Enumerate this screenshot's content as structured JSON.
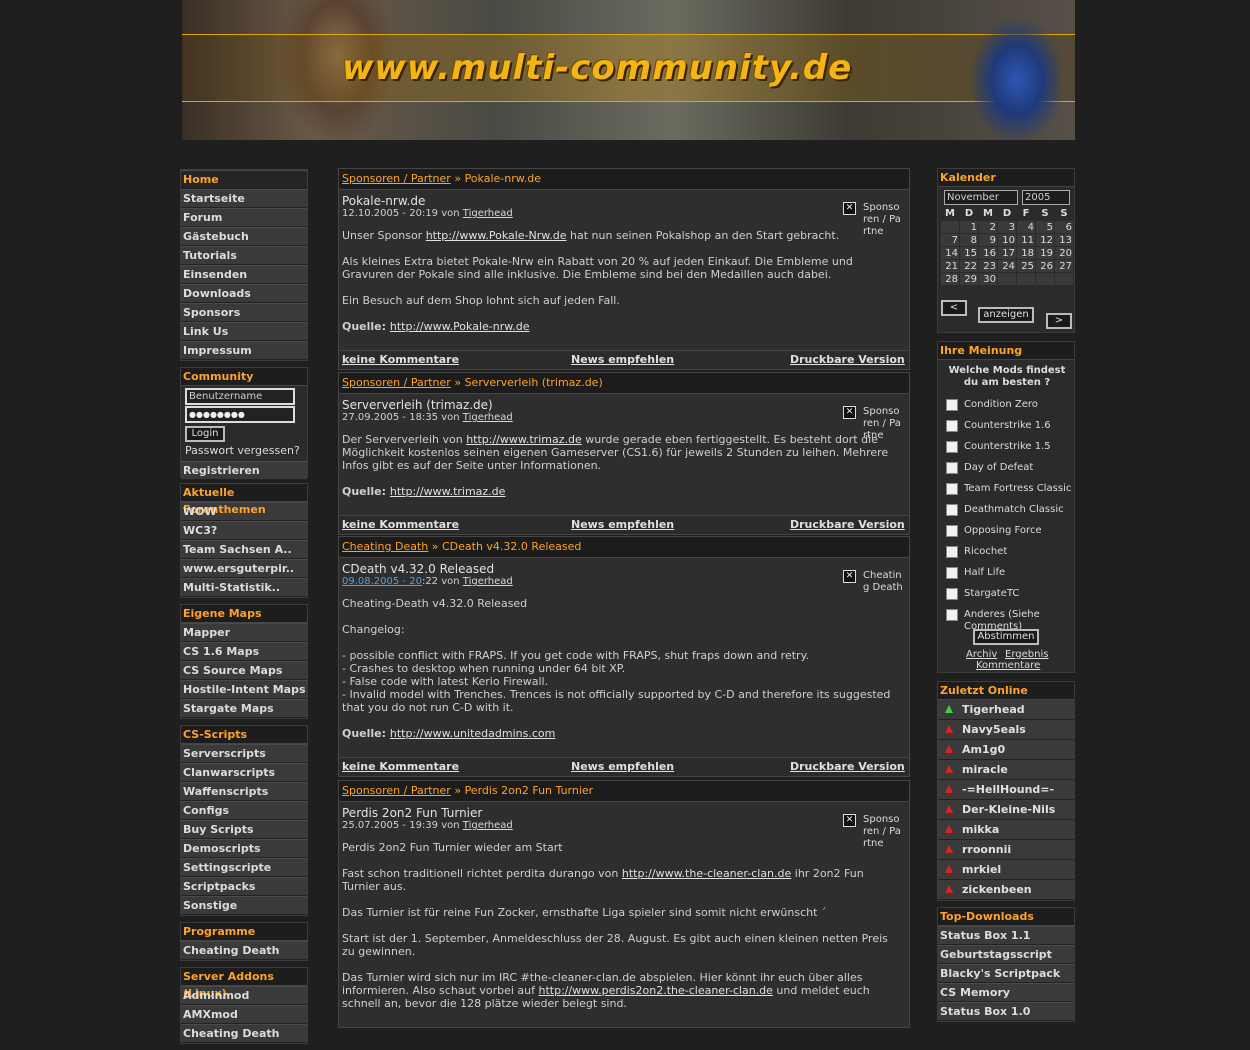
{
  "header": {
    "logo_text": "www.multi-community.de"
  },
  "menu": {
    "title": "Home",
    "items": [
      "Startseite",
      "Forum",
      "Gästebuch",
      "Tutorials",
      "Einsenden",
      "Downloads",
      "Sponsors",
      "Link Us",
      "Impressum"
    ]
  },
  "community": {
    "title": "Community",
    "username_value": "Benutzername",
    "password_value": "●●●●●●●●",
    "login_label": "Login",
    "forgot_label": "Passwort vergessen?",
    "register_label": "Registrieren"
  },
  "forum": {
    "title": "Aktuelle Forenthemen",
    "items": [
      "WOW",
      "WC3?",
      "Team Sachsen A..",
      "www.ersguterpir..",
      "Multi-Statistik.."
    ]
  },
  "maps": {
    "title": "Eigene Maps",
    "items": [
      "Mapper",
      "CS 1.6 Maps",
      "CS Source Maps",
      "Hostile-Intent Maps",
      "Stargate Maps"
    ]
  },
  "scripts": {
    "title": "CS-Scripts",
    "items": [
      "Serverscripts",
      "Clanwarscripts",
      "Waffenscripts",
      "Configs",
      "Buy Scripts",
      "Demoscripts",
      "Settingscripte",
      "Scriptpacks",
      "Sonstige"
    ]
  },
  "programme": {
    "title": "Programme",
    "items": [
      "Cheating Death"
    ]
  },
  "addons": {
    "title": "Server Addons (Linux)",
    "items": [
      "Adminmod",
      "AMXmod",
      "Cheating Death"
    ]
  },
  "news": [
    {
      "category": "Sponsoren / Partner",
      "sep": "»",
      "headline": "Pokale-nrw.de",
      "title": "Pokale-nrw.de",
      "date": "12.10.2005 - 20:19",
      "von": "von",
      "author": "Tigerhead",
      "cat_label": "Sponsoren / Partne",
      "paragraphs": [
        {
          "pre": "Unser Sponsor ",
          "link": "http://www.Pokale-Nrw.de",
          "post": " hat nun seinen Pokalshop an den Start gebracht."
        },
        {
          "pre": "Als kleines Extra bietet Pokale-Nrw ein Rabatt von 20 % auf jeden Einkauf. Die Embleme und Gravuren der Pokale sind alle inklusive. Die Embleme sind bei den Medaillen auch dabei.",
          "link": "",
          "post": ""
        },
        {
          "pre": "Ein Besuch auf dem Shop lohnt sich auf jeden Fall.",
          "link": "",
          "post": ""
        }
      ],
      "quelle_label": "Quelle:",
      "quelle_link": "http://www.Pokale-nrw.de"
    },
    {
      "category": "Sponsoren / Partner",
      "sep": "»",
      "headline": "Serververleih (trimaz.de)",
      "title": "Serververleih (trimaz.de)",
      "date": "27.09.2005 - 18:35",
      "von": "von",
      "author": "Tigerhead",
      "cat_label": "Sponsoren / Partne",
      "paragraphs": [
        {
          "pre": "Der Serververleih von ",
          "link": "http://www.trimaz.de",
          "post": " wurde gerade eben fertiggestellt. Es besteht dort die Möglichkeit kostenlos seinen eigenen Gameserver (CS1.6) für jeweils 2 Stunden zu leihen. Mehrere Infos gibt es auf der Seite unter Informationen."
        }
      ],
      "quelle_label": "Quelle:",
      "quelle_link": "http://www.trimaz.de"
    },
    {
      "category": "Cheating Death",
      "sep": "»",
      "headline": "CDeath v4.32.0 Released",
      "title": "CDeath v4.32.0 Released",
      "date_hl": "09.08.2005 - 20",
      "date_rest": ":22",
      "von": "von",
      "author": "Tigerhead",
      "cat_label": "Cheating Death",
      "paragraphs": [
        {
          "pre": "Cheating-Death v4.32.0 Released",
          "link": "",
          "post": ""
        },
        {
          "pre": "Changelog:",
          "link": "",
          "post": ""
        },
        {
          "pre": "- possible conflict with FRAPS. If you get code with FRAPS, shut fraps down and retry.\n- Crashes to desktop when running under 64 bit XP.\n- False code with latest Kerio Firewall.\n- Invalid model with Trenches. Trences is not officially supported by C-D and therefore its suggested that you do not run C-D with it.",
          "link": "",
          "post": ""
        }
      ],
      "quelle_label": "Quelle:",
      "quelle_link": "http://www.unitedadmins.com"
    },
    {
      "category": "Sponsoren / Partner",
      "sep": "»",
      "headline": "Perdis 2on2 Fun Turnier",
      "title": "Perdis 2on2 Fun Turnier",
      "date": "25.07.2005 - 19:39",
      "von": "von",
      "author": "Tigerhead",
      "cat_label": "Sponsoren / Partne",
      "paragraphs": [
        {
          "pre": "Perdis 2on2 Fun Turnier wieder am Start",
          "link": "",
          "post": ""
        },
        {
          "pre": "Fast schon traditionell richtet perdita durango von ",
          "link": "http://www.the-cleaner-clan.de",
          "post": " ihr 2on2 Fun Turnier aus."
        },
        {
          "pre": "Das Turnier ist für reine Fun Zocker, ernsthafte Liga spieler sind somit nicht erwünscht  ´",
          "link": "",
          "post": ""
        },
        {
          "pre": "Start ist der 1. September, Anmeldeschluss der 28. August. Es gibt auch einen kleinen netten Preis zu gewinnen.",
          "link": "",
          "post": ""
        },
        {
          "pre": "Das Turnier wird sich nur im IRC #the-cleaner-clan.de abspielen. Hier könnt ihr euch über alles informieren. Also schaut vorbei auf ",
          "link": "http://www.perdis2on2.the-cleaner-clan.de",
          "post": " und meldet euch schnell an, bevor die 128 plätze wieder belegt sind."
        }
      ],
      "quelle_label": "",
      "quelle_link": ""
    }
  ],
  "news_footer": {
    "comments": "keine Kommentare",
    "recommend": "News empfehlen",
    "print": "Druckbare Version"
  },
  "calendar": {
    "title": "Kalender",
    "month": "November",
    "year": "2005",
    "weekdays": [
      "M",
      "D",
      "M",
      "D",
      "F",
      "S",
      "S"
    ],
    "weeks": [
      [
        "",
        "",
        "1",
        "2",
        "3",
        "4",
        "5",
        "6"
      ],
      [
        "7",
        "8",
        "9",
        "10",
        "11",
        "12",
        "13"
      ],
      [
        "14",
        "15",
        "16",
        "17",
        "18",
        "19",
        "20"
      ],
      [
        "21",
        "22",
        "23",
        "24",
        "25",
        "26",
        "27"
      ],
      [
        "28",
        "29",
        "30",
        "",
        "",
        "",
        ""
      ]
    ],
    "prev_label": "<",
    "show_label": "anzeigen",
    "next_label": ">"
  },
  "poll": {
    "title": "Ihre Meinung",
    "question": "Welche Mods findest du am besten ?",
    "options": [
      "Condition Zero",
      "Counterstrike 1.6",
      "Counterstrike 1.5",
      "Day of Defeat",
      "Team Fortress Classic",
      "Deathmatch Classic",
      "Opposing Force",
      "Ricochet",
      "Half Life",
      "StargateTC",
      "Anderes (Siehe Comments)"
    ],
    "vote_label": "Abstimmen",
    "archive_label": "Archiv",
    "result_label": "Ergebnis",
    "comments_label": "Kommentare"
  },
  "online": {
    "title": "Zuletzt Online",
    "users": [
      {
        "name": "Tigerhead",
        "online": true
      },
      {
        "name": "Navy5eals",
        "online": false
      },
      {
        "name": "Am1g0",
        "online": false
      },
      {
        "name": "miracle",
        "online": false
      },
      {
        "name": "-=HellHound=-",
        "online": false
      },
      {
        "name": "Der-Kleine-Nils",
        "online": false
      },
      {
        "name": "mikka",
        "online": false
      },
      {
        "name": "rroonnii",
        "online": false
      },
      {
        "name": "mrkiel",
        "online": false
      },
      {
        "name": "zickenbeen",
        "online": false
      }
    ]
  },
  "downloads": {
    "title": "Top-Downloads",
    "items": [
      "Status Box 1.1",
      "Geburtstagsscript",
      "Blacky's Scriptpack",
      "CS Memory",
      "Status Box 1.0"
    ]
  }
}
